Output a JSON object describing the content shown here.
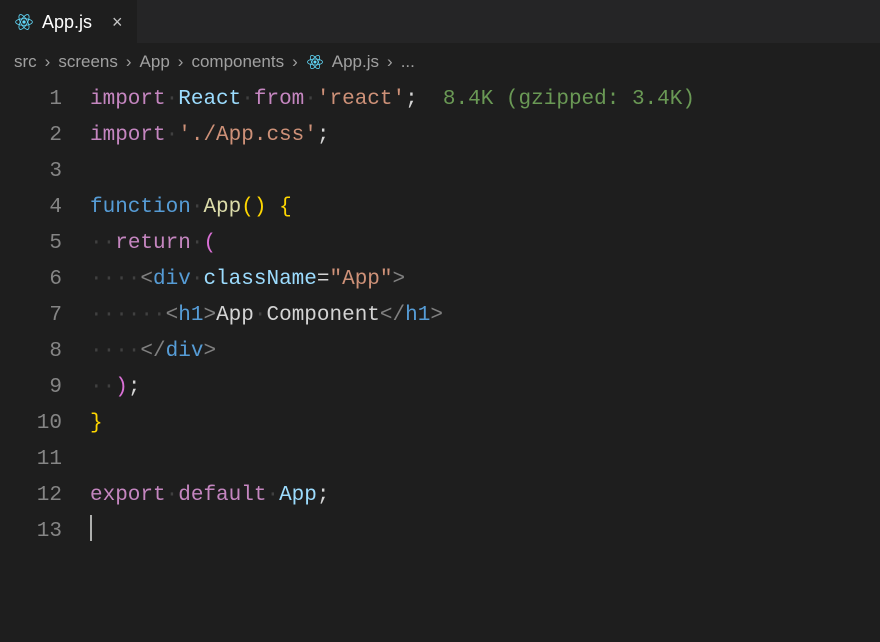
{
  "tab": {
    "filename": "App.js",
    "close_glyph": "×"
  },
  "breadcrumbs": {
    "items": [
      "src",
      "screens",
      "App",
      "components",
      "App.js",
      "..."
    ],
    "sep": "›"
  },
  "gutter": {
    "lines": [
      "1",
      "2",
      "3",
      "4",
      "5",
      "6",
      "7",
      "8",
      "9",
      "10",
      "11",
      "12",
      "13"
    ]
  },
  "code": {
    "l1": {
      "import": "import",
      "ws1": "·",
      "react": "React",
      "ws2": "·",
      "from": "from",
      "ws3": "·",
      "str": "'react'",
      "semi": ";",
      "hint": "  8.4K (gzipped: 3.4K)"
    },
    "l2": {
      "import": "import",
      "ws1": "·",
      "str": "'./App.css'",
      "semi": ";"
    },
    "l4": {
      "function": "function",
      "ws1": "·",
      "name": "App",
      "parens": "()",
      "ws2": " ",
      "brace": "{"
    },
    "l5": {
      "ws": "··",
      "return": "return",
      "ws2": "·",
      "paren": "("
    },
    "l6": {
      "ws": "····",
      "lt": "<",
      "tag": "div",
      "ws2": "·",
      "attr": "className",
      "eq": "=",
      "str": "\"App\"",
      "gt": ">"
    },
    "l7": {
      "ws": "······",
      "lt": "<",
      "tag": "h1",
      "gt": ">",
      "text1": "App",
      "wsm": "·",
      "text2": "Component",
      "lt2": "</",
      "tag2": "h1",
      "gt2": ">"
    },
    "l8": {
      "ws": "····",
      "lt": "</",
      "tag": "div",
      "gt": ">"
    },
    "l9": {
      "ws": "··",
      "paren": ")",
      "semi": ";"
    },
    "l10": {
      "brace": "}"
    },
    "l12": {
      "export": "export",
      "ws1": "·",
      "default": "default",
      "ws2": "·",
      "name": "App",
      "semi": ";"
    }
  }
}
